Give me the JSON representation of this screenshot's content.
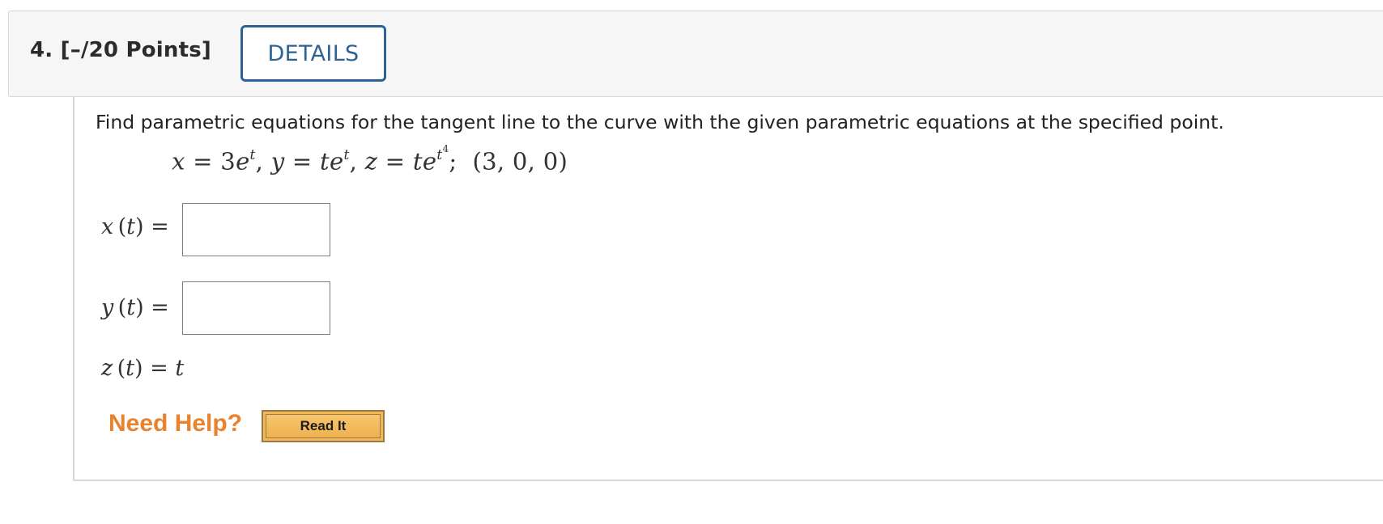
{
  "question": {
    "number_label": "4.",
    "points_label": "[–/20 Points]",
    "details_button": "DETAILS"
  },
  "prompt": "Find parametric equations for the tangent line to the curve with the given parametric equations at the specified point.",
  "equations": {
    "x_var": "x",
    "x_rhs_coef": "3",
    "x_rhs_base": "e",
    "x_rhs_exp": "t",
    "y_var": "y",
    "y_rhs_t": "t",
    "y_rhs_base": "e",
    "y_rhs_exp": "t",
    "z_var": "z",
    "z_rhs_t": "t",
    "z_rhs_base": "e",
    "z_rhs_exp_base": "t",
    "z_rhs_exp_pow": "4",
    "point": "(3, 0, 0)"
  },
  "answers": {
    "x_label_var": "x",
    "x_label_arg": "t",
    "x_value": "",
    "y_label_var": "y",
    "y_label_arg": "t",
    "y_value": "",
    "z_label_var": "z",
    "z_label_arg": "t",
    "z_value": "t"
  },
  "help": {
    "label": "Need Help?",
    "read_it_button": "Read It"
  }
}
